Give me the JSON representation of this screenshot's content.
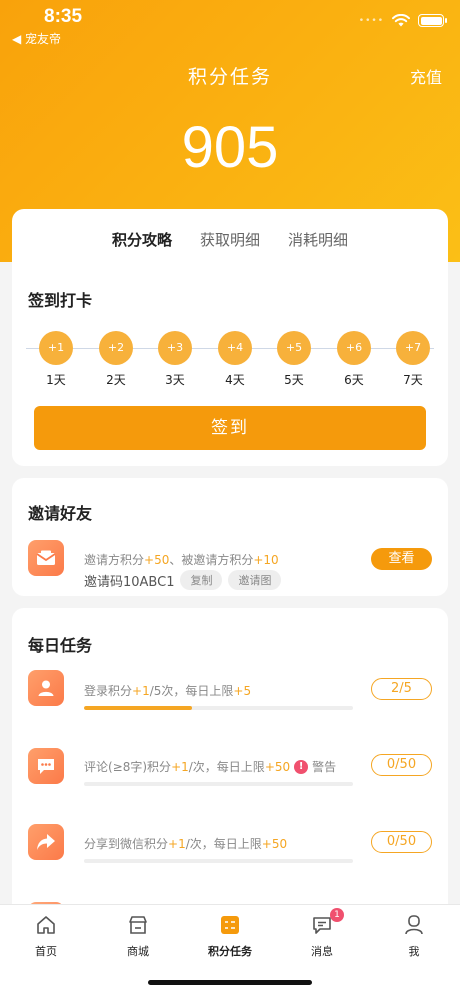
{
  "status_bar": {
    "time": "8:35",
    "back_app": "◀ 宠友帝",
    "signal_dots": "••••"
  },
  "header": {
    "title": "积分任务",
    "recharge_label": "充值",
    "points": "905"
  },
  "tabs": [
    {
      "label": "积分攻略",
      "active": true
    },
    {
      "label": "获取明细",
      "active": false
    },
    {
      "label": "消耗明细",
      "active": false
    }
  ],
  "checkin": {
    "title": "签到打卡",
    "days": [
      {
        "reward": "+1",
        "label": "1天"
      },
      {
        "reward": "+2",
        "label": "2天"
      },
      {
        "reward": "+3",
        "label": "3天"
      },
      {
        "reward": "+4",
        "label": "4天"
      },
      {
        "reward": "+5",
        "label": "5天"
      },
      {
        "reward": "+6",
        "label": "6天"
      },
      {
        "reward": "+7",
        "label": "7天"
      }
    ],
    "button_label": "签到"
  },
  "invite": {
    "title": "邀请好友",
    "desc_prefix": "邀请方积分",
    "desc_inviter": "+50",
    "desc_middle": "、被邀请方积分",
    "desc_invitee": "+10",
    "code_text": "邀请码10ABC1",
    "copy_label": "复制",
    "image_label": "邀请图",
    "view_label": "查看"
  },
  "daily": {
    "title": "每日任务",
    "tasks": [
      {
        "name": "登录积分",
        "per": "+1",
        "unit": "/5次，每日上限",
        "limit": "+5",
        "warning": "",
        "progress": "2/5",
        "progress_fraction": 0.4
      },
      {
        "name": "评论(≥8字)积分",
        "per": "+1",
        "unit": "/次，每日上限",
        "limit": "+50",
        "warning": "警告",
        "progress": "0/50",
        "progress_fraction": 0
      },
      {
        "name": "分享到微信积分",
        "per": "+1",
        "unit": "/次，每日上限",
        "limit": "+50",
        "warning": "",
        "progress": "0/50",
        "progress_fraction": 0
      }
    ]
  },
  "tabbar": {
    "items": [
      {
        "label": "首页",
        "icon": "home-icon"
      },
      {
        "label": "商城",
        "icon": "store-icon"
      },
      {
        "label": "积分任务",
        "icon": "points-task-icon",
        "active": true
      },
      {
        "label": "消息",
        "icon": "message-icon",
        "badge": "1"
      },
      {
        "label": "我",
        "icon": "profile-icon"
      }
    ]
  },
  "colors": {
    "primary": "#F59A0C",
    "accent": "#F5A623",
    "coin": "#F7B13B",
    "badge": "#F0506E",
    "task_icon": "#FB7A49"
  }
}
